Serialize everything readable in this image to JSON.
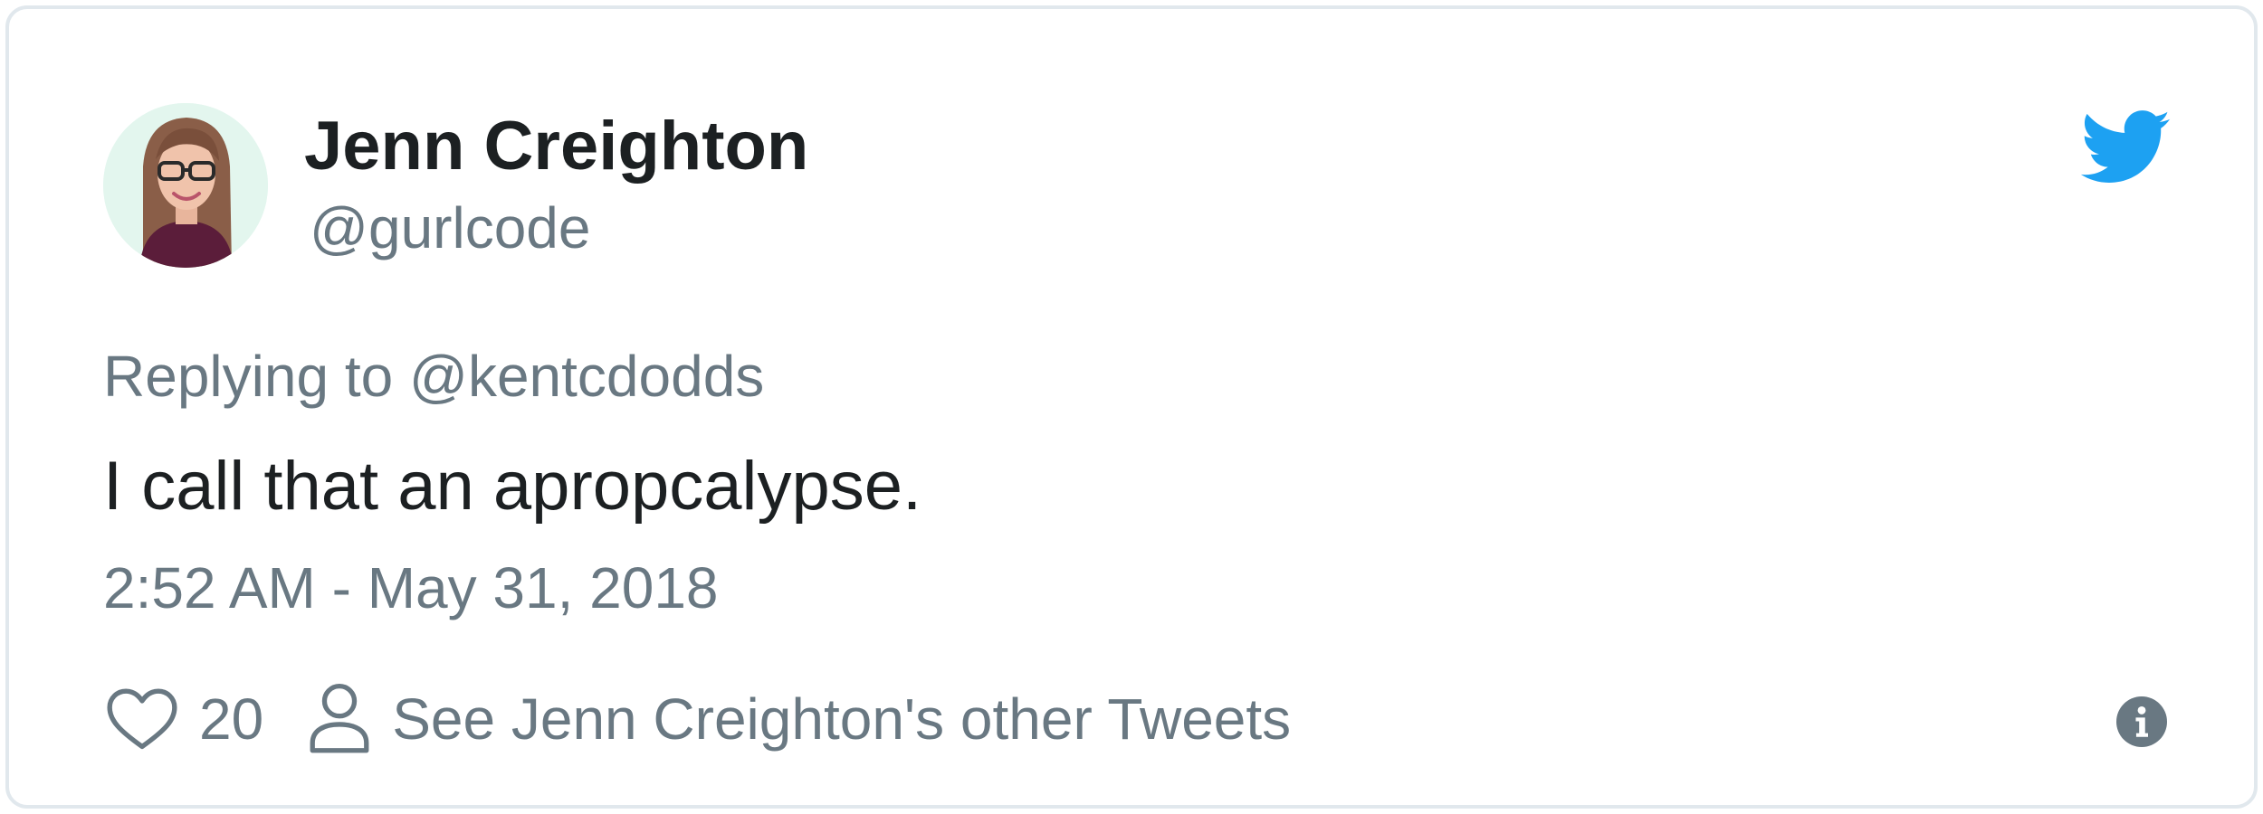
{
  "tweet": {
    "author_name": "Jenn Creighton",
    "author_handle": "@gurlcode",
    "reply_to": "Replying to @kentcdodds",
    "text": "I call that an apropcalypse.",
    "timestamp": "2:52 AM - May 31, 2018",
    "like_count": "20",
    "other_tweets_label": "See Jenn Creighton's other Tweets"
  },
  "icons": {
    "brand": "twitter-bird-icon",
    "like": "heart-icon",
    "profile": "person-icon",
    "info": "info-icon"
  },
  "colors": {
    "text_primary": "#1c2022",
    "text_secondary": "#697882",
    "twitter_blue": "#1da1f2",
    "border": "#e1e8ed"
  }
}
